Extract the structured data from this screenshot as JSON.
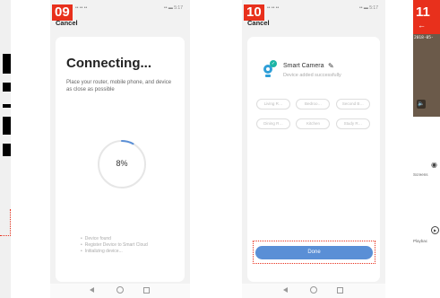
{
  "steps": [
    {
      "badge": "09",
      "status_left": "•• •• ••",
      "status_right": "•• ▬ 5:17",
      "cancel_label": "Cancel",
      "title": "Connecting...",
      "description": "Place your router, mobile phone, and device as close as possible",
      "progress_percent_label": "8%",
      "progress_fraction": 0.08,
      "status_list": [
        "Device found",
        "Register Device to Smart Cloud",
        "Initializing device..."
      ]
    },
    {
      "badge": "10",
      "status_left": "•• •• ••",
      "status_right": "•• ▬ 5:17",
      "cancel_label": "Cancel",
      "device_name": "Smart Camera",
      "device_status": "Device added successfully",
      "room_chips": [
        "Living R…",
        "Bedroo…",
        "Second B…",
        "Dining R…",
        "Kitchen",
        "Study R…"
      ],
      "done_label": "Done"
    },
    {
      "badge": "11",
      "back_icon": "arrow-left-icon",
      "video_timestamp": "2018-05-",
      "screenshot_label": "Screens",
      "playback_label": "Playbac"
    }
  ],
  "colors": {
    "badge": "#e8301c",
    "accent_blue": "#5a8fd6",
    "success_teal": "#1bb5a5",
    "highlight_dotted": "#e8301c"
  }
}
